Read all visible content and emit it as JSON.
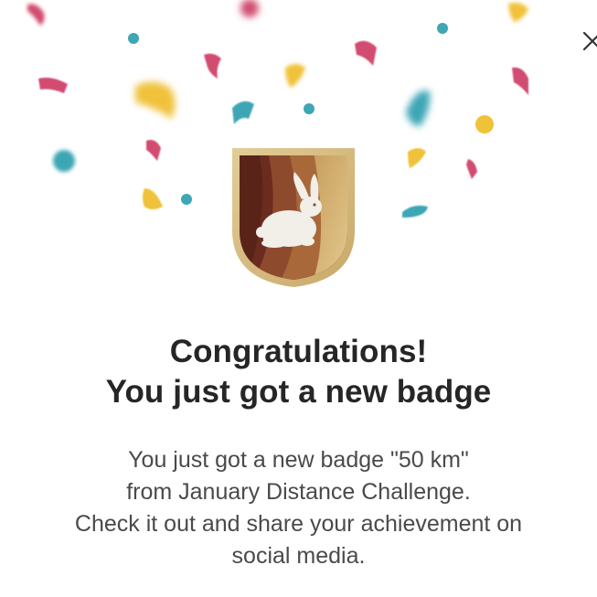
{
  "modal": {
    "close_symbol": "×",
    "title_line1": "Congratulations!",
    "title_line2": "You just got a new badge",
    "message_line1": "You just got a new badge \"50 km\"",
    "message_line2": "from January Distance Challenge.",
    "message_line3": "Check it out and share your achievement on",
    "message_line4": "social media."
  },
  "badge": {
    "icon": "rabbit-icon",
    "frame_color": "#d9c08c",
    "stripe_colors": [
      "#6b2c1f",
      "#8e4a2c",
      "#b5733c",
      "#c9a15e"
    ]
  },
  "confetti_colors": {
    "pink": "#d24b6f",
    "yellow": "#f0c23a",
    "teal": "#3ea6b5"
  }
}
